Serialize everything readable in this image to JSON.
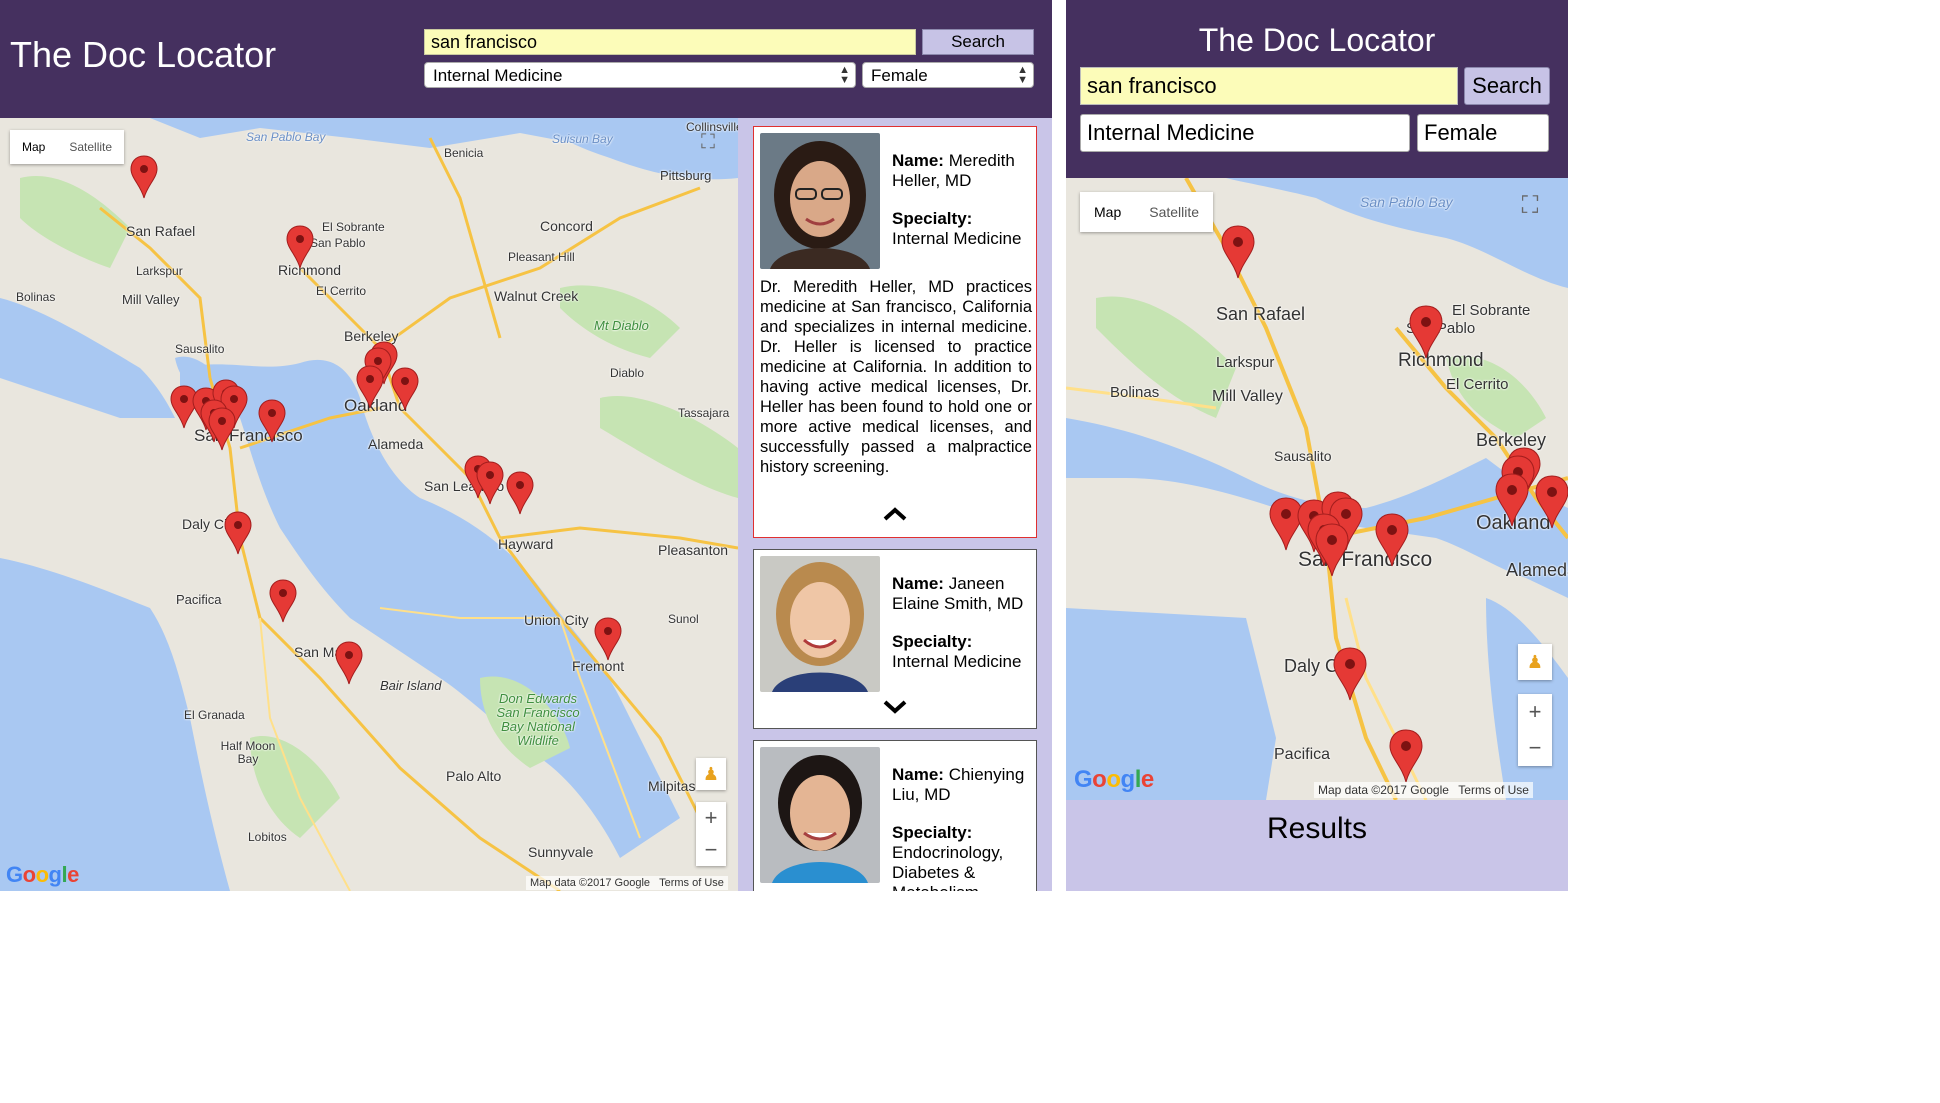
{
  "app": {
    "title": "The Doc Locator"
  },
  "search": {
    "query": "san francisco",
    "button_label": "Search",
    "specialty_value": "Internal Medicine",
    "gender_value": "Female"
  },
  "map": {
    "type_map": "Map",
    "type_satellite": "Satellite",
    "google_label": "Google",
    "attribution": "Map data ©2017 Google",
    "terms": "Terms of Use",
    "zoom_in": "+",
    "zoom_out": "−",
    "places_desktop": [
      {
        "name": "San Rafael",
        "kind": "town"
      },
      {
        "name": "Richmond",
        "kind": "city"
      },
      {
        "name": "El Sobrante",
        "kind": "town"
      },
      {
        "name": "San Pablo",
        "kind": "town"
      },
      {
        "name": "Concord",
        "kind": "city"
      },
      {
        "name": "Pleasant Hill",
        "kind": "town"
      },
      {
        "name": "Walnut Creek",
        "kind": "city"
      },
      {
        "name": "Benicia",
        "kind": "town"
      },
      {
        "name": "Pittsburg",
        "kind": "town"
      },
      {
        "name": "Larkspur",
        "kind": "town"
      },
      {
        "name": "Mill Valley",
        "kind": "town"
      },
      {
        "name": "Bolinas",
        "kind": "town"
      },
      {
        "name": "Sausalito",
        "kind": "town"
      },
      {
        "name": "El Cerrito",
        "kind": "town"
      },
      {
        "name": "Berkeley",
        "kind": "city"
      },
      {
        "name": "Oakland",
        "kind": "city"
      },
      {
        "name": "San Francisco",
        "kind": "city"
      },
      {
        "name": "Alameda",
        "kind": "city"
      },
      {
        "name": "Mt Diablo",
        "kind": "park"
      },
      {
        "name": "Diablo",
        "kind": "town"
      },
      {
        "name": "Tassajara",
        "kind": "town"
      },
      {
        "name": "San Leandro",
        "kind": "city"
      },
      {
        "name": "Hayward",
        "kind": "city"
      },
      {
        "name": "Pleasanton",
        "kind": "city"
      },
      {
        "name": "Daly City",
        "kind": "city"
      },
      {
        "name": "Pacifica",
        "kind": "town"
      },
      {
        "name": "Union City",
        "kind": "city"
      },
      {
        "name": "Sunol",
        "kind": "town"
      },
      {
        "name": "Fremont",
        "kind": "city"
      },
      {
        "name": "San Mateo",
        "kind": "city"
      },
      {
        "name": "Bair Island",
        "kind": "town"
      },
      {
        "name": "El Granada",
        "kind": "town"
      },
      {
        "name": "Half Moon Bay",
        "kind": "town"
      },
      {
        "name": "Don Edwards San Francisco Bay National Wildlife",
        "kind": "park"
      },
      {
        "name": "Palo Alto",
        "kind": "city"
      },
      {
        "name": "Milpitas",
        "kind": "city"
      },
      {
        "name": "Lobitos",
        "kind": "town"
      },
      {
        "name": "Sunnyvale",
        "kind": "city"
      },
      {
        "name": "San Pablo Bay",
        "kind": "water"
      },
      {
        "name": "Suisun Bay",
        "kind": "water"
      },
      {
        "name": "Collinsville",
        "kind": "town"
      }
    ]
  },
  "results": {
    "heading": "Results",
    "name_label": "Name:",
    "specialty_label": "Specialty:",
    "doctors": [
      {
        "name": "Meredith Heller, MD",
        "specialty": "Internal Medicine",
        "bio": "Dr. Meredith Heller, MD practices medicine at San francisco, California and specializes in internal medicine. Dr. Heller is licensed to practice medicine at California. In addition to having active medical licenses, Dr. Heller has been found to hold one or more active medical licenses, and successfully passed a malpractice history screening.",
        "expanded": true,
        "toggle": "collapse-chevron"
      },
      {
        "name": "Janeen Elaine Smith, MD",
        "specialty": "Internal Medicine",
        "expanded": false,
        "toggle": "expand-chevron"
      },
      {
        "name": "Chienying Liu, MD",
        "specialty": "Endocrinology, Diabetes & Metabolism",
        "expanded": false
      }
    ]
  },
  "colors": {
    "header": "#45305f",
    "results_bg": "#c9c5e8",
    "search_bg": "#fcfcb9",
    "button_bg": "#c7c3e6",
    "marker": "#e53935",
    "water": "#a9c8f2",
    "land": "#e9e6de",
    "park": "#c6e4b3"
  }
}
